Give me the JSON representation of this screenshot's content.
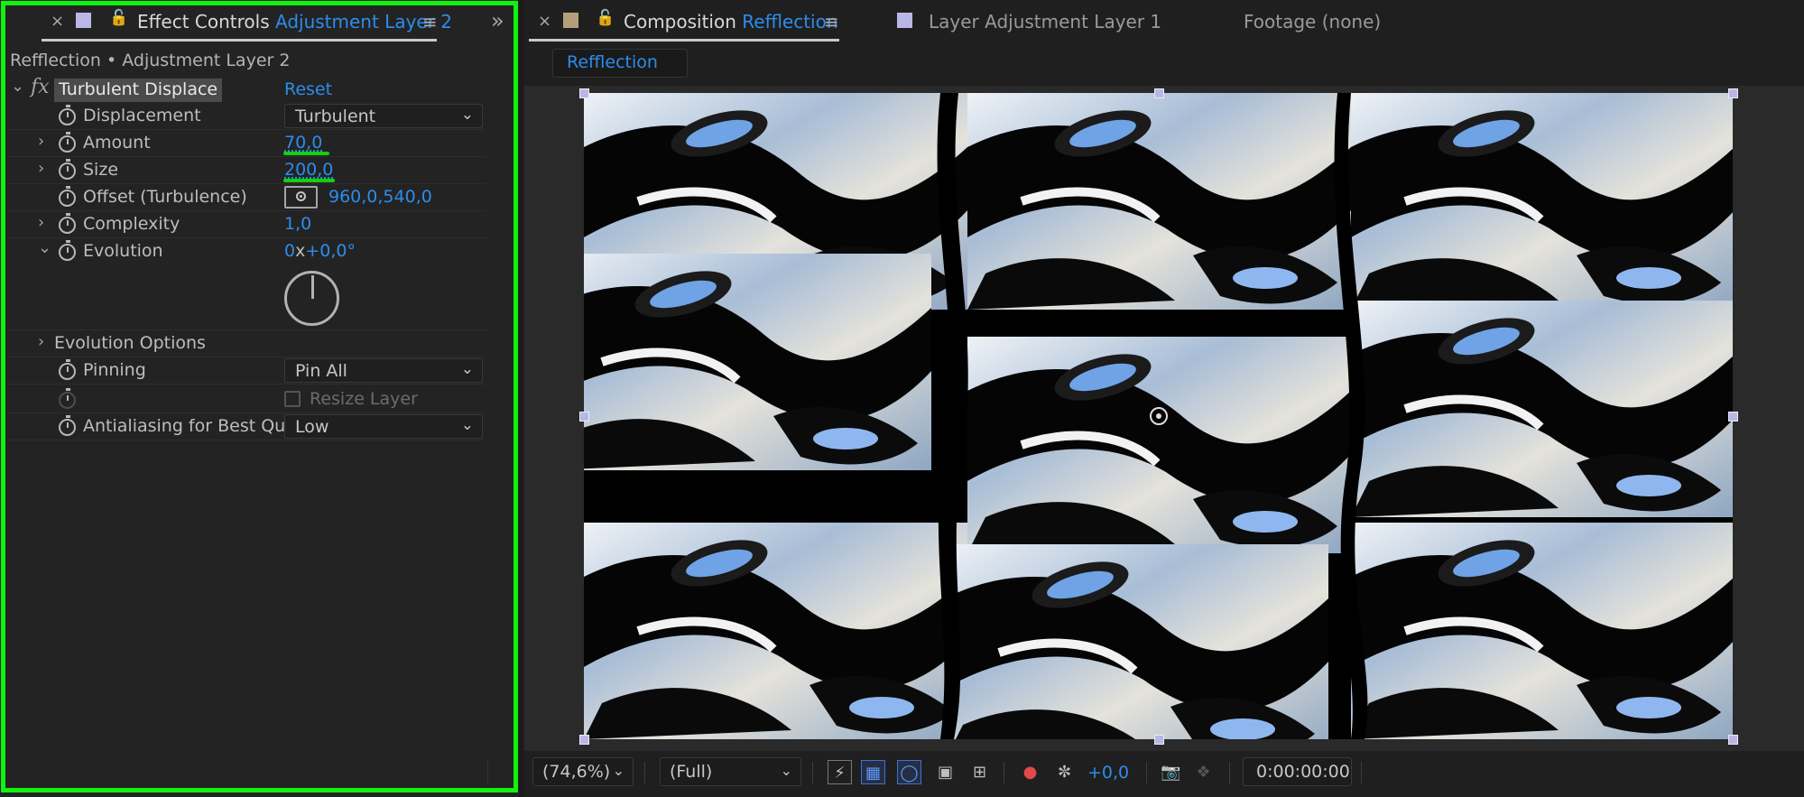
{
  "effect_controls": {
    "tab_close": "×",
    "tab_title_prefix": "Effect Controls",
    "tab_title_layer": "Adjustment Layer 2",
    "menu_icon": "≡",
    "expand_icon": "»",
    "breadcrumb": "Refflection • Adjustment Layer 2",
    "effect": {
      "fx_label": "fx",
      "name": "Turbulent Displace",
      "reset_label": "Reset"
    },
    "properties": {
      "displacement": {
        "label": "Displacement",
        "value": "Turbulent"
      },
      "amount": {
        "label": "Amount",
        "value": "70,0"
      },
      "size": {
        "label": "Size",
        "value": "200,0"
      },
      "offset": {
        "label": "Offset (Turbulence)",
        "value": "960,0,540,0"
      },
      "complexity": {
        "label": "Complexity",
        "value": "1,0"
      },
      "evolution": {
        "label": "Evolution",
        "rev": "0",
        "x": "x",
        "degrees": "+0,0°"
      },
      "evolution_options": {
        "label": "Evolution Options"
      },
      "pinning": {
        "label": "Pinning",
        "value": "Pin All"
      },
      "resize_layer": {
        "label": "Resize Layer"
      },
      "antialiasing": {
        "label": "Antialiasing for Best Qua",
        "value": "Low"
      }
    }
  },
  "composition": {
    "tab_close": "×",
    "tab_title_prefix": "Composition",
    "tab_title_name": "Refflection",
    "menu_icon": "≡",
    "layer_tab": "Layer Adjustment Layer 1",
    "footage_tab": "Footage (none)",
    "sub_tab": "Refflection"
  },
  "viewer_toolbar": {
    "zoom": "(74,6%)",
    "resolution": "(Full)",
    "exposure": "+0,0",
    "timecode": "0:00:00:00"
  },
  "colors": {
    "accent_blue": "#2d8ceb",
    "highlight_green": "#11f20f",
    "panel_bg": "#232323",
    "swatch_lavender": "#b9b7e5",
    "swatch_tan": "#b59f7a"
  }
}
